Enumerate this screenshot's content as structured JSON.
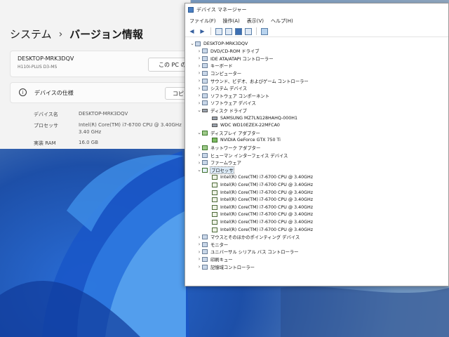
{
  "settings": {
    "breadcrumb_parent": "システム",
    "breadcrumb_sep": "›",
    "breadcrumb_current": "バージョン情報",
    "device_name_header": "DESKTOP-MRK3DQV",
    "device_model": "H110I-PLUS D3-MS",
    "rename_button": "この PC の名前を",
    "spec_section_title": "デバイスの仕様",
    "copy_button": "コピー",
    "specs": [
      {
        "label": "デバイス名",
        "value": "DESKTOP-MRK3DQV"
      },
      {
        "label": "プロセッサ",
        "value": "Intel(R) Core(TM) i7-6700 CPU @ 3.40GHz"
      },
      {
        "label": "",
        "value": "3.40 GHz"
      },
      {
        "label": "実装 RAM",
        "value": "16.0 GB"
      }
    ]
  },
  "devmgr": {
    "title": "デバイス マネージャー",
    "menu": [
      "ファイル(F)",
      "操作(A)",
      "表示(V)",
      "ヘルプ(H)"
    ],
    "tree": [
      {
        "depth": 0,
        "chev": "⌄",
        "icon": "computer",
        "label": "DESKTOP-MRK3DQV"
      },
      {
        "depth": 1,
        "chev": "›",
        "icon": "dvd",
        "label": "DVD/CD-ROM ドライブ"
      },
      {
        "depth": 1,
        "chev": "›",
        "icon": "ide",
        "label": "IDE ATA/ATAPI コントローラー"
      },
      {
        "depth": 1,
        "chev": "›",
        "icon": "keyboard",
        "label": "キーボード"
      },
      {
        "depth": 1,
        "chev": "›",
        "icon": "computer",
        "label": "コンピューター"
      },
      {
        "depth": 1,
        "chev": "›",
        "icon": "sound",
        "label": "サウンド、ビデオ、およびゲーム コントローラー"
      },
      {
        "depth": 1,
        "chev": "›",
        "icon": "system",
        "label": "システム デバイス"
      },
      {
        "depth": 1,
        "chev": "›",
        "icon": "software",
        "label": "ソフトウェア コンポーネント"
      },
      {
        "depth": 1,
        "chev": "›",
        "icon": "software",
        "label": "ソフトウェア デバイス"
      },
      {
        "depth": 1,
        "chev": "⌄",
        "icon": "disk",
        "label": "ディスク ドライブ"
      },
      {
        "depth": 2,
        "chev": "",
        "icon": "disk",
        "label": "SAMSUNG MZ7LN128HAHQ-000H1"
      },
      {
        "depth": 2,
        "chev": "",
        "icon": "disk",
        "label": "WDC WD10EZEX-22MFCA0"
      },
      {
        "depth": 1,
        "chev": "⌄",
        "icon": "display",
        "label": "ディスプレイ アダプター"
      },
      {
        "depth": 2,
        "chev": "",
        "icon": "gpu",
        "label": "NVIDIA GeForce GTX 750 Ti"
      },
      {
        "depth": 1,
        "chev": "›",
        "icon": "network",
        "label": "ネットワーク アダプター"
      },
      {
        "depth": 1,
        "chev": "›",
        "icon": "hid",
        "label": "ヒューマン インターフェイス デバイス"
      },
      {
        "depth": 1,
        "chev": "›",
        "icon": "firmware",
        "label": "ファームウェア"
      },
      {
        "depth": 1,
        "chev": "⌄",
        "icon": "processor",
        "label": "プロセッサ",
        "selected": true
      },
      {
        "depth": 2,
        "chev": "",
        "icon": "cpu",
        "label": "Intel(R) Core(TM) i7-6700 CPU @ 3.40GHz"
      },
      {
        "depth": 2,
        "chev": "",
        "icon": "cpu",
        "label": "Intel(R) Core(TM) i7-6700 CPU @ 3.40GHz"
      },
      {
        "depth": 2,
        "chev": "",
        "icon": "cpu",
        "label": "Intel(R) Core(TM) i7-6700 CPU @ 3.40GHz"
      },
      {
        "depth": 2,
        "chev": "",
        "icon": "cpu",
        "label": "Intel(R) Core(TM) i7-6700 CPU @ 3.40GHz"
      },
      {
        "depth": 2,
        "chev": "",
        "icon": "cpu",
        "label": "Intel(R) Core(TM) i7-6700 CPU @ 3.40GHz"
      },
      {
        "depth": 2,
        "chev": "",
        "icon": "cpu",
        "label": "Intel(R) Core(TM) i7-6700 CPU @ 3.40GHz"
      },
      {
        "depth": 2,
        "chev": "",
        "icon": "cpu",
        "label": "Intel(R) Core(TM) i7-6700 CPU @ 3.40GHz"
      },
      {
        "depth": 2,
        "chev": "",
        "icon": "cpu",
        "label": "Intel(R) Core(TM) i7-6700 CPU @ 3.40GHz"
      },
      {
        "depth": 1,
        "chev": "›",
        "icon": "mouse",
        "label": "マウスとそのほかのポインティング デバイス"
      },
      {
        "depth": 1,
        "chev": "›",
        "icon": "monitor",
        "label": "モニター"
      },
      {
        "depth": 1,
        "chev": "›",
        "icon": "usb",
        "label": "ユニバーサル シリアル バス コントローラー"
      },
      {
        "depth": 1,
        "chev": "›",
        "icon": "printer",
        "label": "印刷キュー"
      },
      {
        "depth": 1,
        "chev": "›",
        "icon": "storage",
        "label": "記憶域コントローラー"
      }
    ]
  }
}
